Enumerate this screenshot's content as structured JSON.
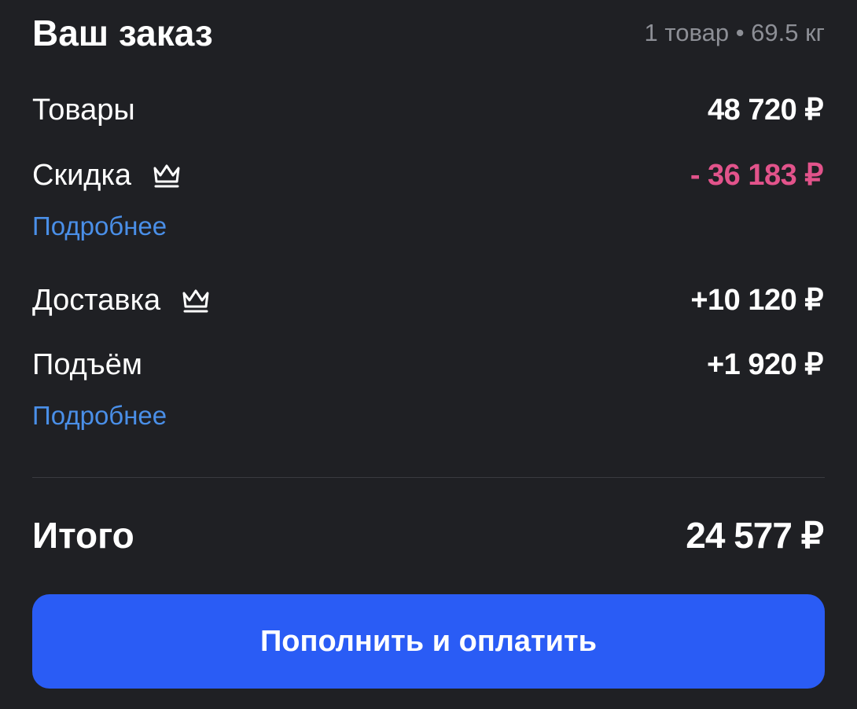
{
  "header": {
    "title": "Ваш заказ",
    "meta": "1 товар • 69.5 кг"
  },
  "rows": {
    "goods": {
      "label": "Товары",
      "value": "48 720 ₽"
    },
    "discount": {
      "label": "Скидка",
      "value": "- 36 183 ₽",
      "icon": "crown-icon",
      "color": "#e2538b"
    },
    "discount_link": "Подробнее",
    "delivery": {
      "label": "Доставка",
      "value": "+10 120 ₽",
      "icon": "crown-icon"
    },
    "lift": {
      "label": "Подъём",
      "value": "+1 920 ₽"
    },
    "lift_link": "Подробнее"
  },
  "total": {
    "label": "Итого",
    "value": "24 577 ₽"
  },
  "pay_button": {
    "label": "Пополнить и оплатить",
    "color": "#2a5cf5"
  },
  "colors": {
    "background": "#1f2024",
    "link": "#4a8fe8",
    "muted": "#8d8f96"
  }
}
